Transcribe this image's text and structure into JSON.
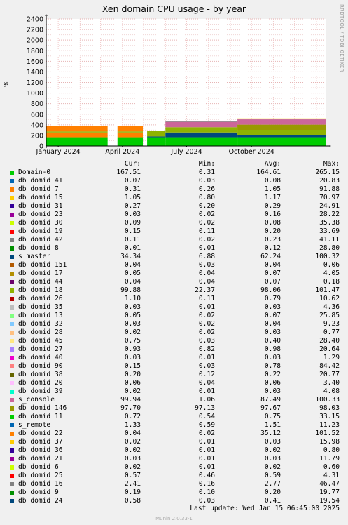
{
  "title": "Xen domain CPU usage - by year",
  "watermark": "RRDTOOL / TOBI OETIKER",
  "footer": {
    "last_update": "Last update:  Wed Jan 15 06:45:00 2025",
    "munin": "Munin 2.0.33-1"
  },
  "legend": {
    "headers": {
      "cur": "Cur:",
      "min": "Min:",
      "avg": "Avg:",
      "max": "Max:"
    },
    "rows": [
      {
        "name": "Domain-0",
        "color": "#00cc00",
        "cur": "167.51",
        "min": "0.31",
        "avg": "164.61",
        "max": "265.15"
      },
      {
        "name": "db domid 41",
        "color": "#0066b3",
        "cur": "0.07",
        "min": "0.03",
        "avg": "0.08",
        "max": "20.83"
      },
      {
        "name": "db domid 7",
        "color": "#ff8000",
        "cur": "0.31",
        "min": "0.26",
        "avg": "1.05",
        "max": "91.88"
      },
      {
        "name": "db domid 15",
        "color": "#ffcc00",
        "cur": "1.05",
        "min": "0.80",
        "avg": "1.17",
        "max": "70.97"
      },
      {
        "name": "db domid 31",
        "color": "#330099",
        "cur": "0.27",
        "min": "0.20",
        "avg": "0.29",
        "max": "24.91"
      },
      {
        "name": "db domid 23",
        "color": "#990099",
        "cur": "0.03",
        "min": "0.02",
        "avg": "0.16",
        "max": "28.22"
      },
      {
        "name": "db domid 30",
        "color": "#ccff00",
        "cur": "0.09",
        "min": "0.02",
        "avg": "0.08",
        "max": "35.38"
      },
      {
        "name": "db domid 19",
        "color": "#ff0000",
        "cur": "0.15",
        "min": "0.11",
        "avg": "0.20",
        "max": "33.69"
      },
      {
        "name": "db domid 42",
        "color": "#808080",
        "cur": "0.11",
        "min": "0.02",
        "avg": "0.23",
        "max": "41.11"
      },
      {
        "name": "db domid 8",
        "color": "#008f00",
        "cur": "0.01",
        "min": "0.01",
        "avg": "0.12",
        "max": "28.80"
      },
      {
        "name": "s_master",
        "color": "#00487d",
        "cur": "34.34",
        "min": "6.88",
        "avg": "62.24",
        "max": "100.32"
      },
      {
        "name": "db domid 151",
        "color": "#b35a00",
        "cur": "0.04",
        "min": "0.03",
        "avg": "0.04",
        "max": "0.06"
      },
      {
        "name": "db domid 17",
        "color": "#b38f00",
        "cur": "0.05",
        "min": "0.04",
        "avg": "0.07",
        "max": "4.05"
      },
      {
        "name": "db domid 44",
        "color": "#6b006b",
        "cur": "0.04",
        "min": "0.04",
        "avg": "0.07",
        "max": "0.18"
      },
      {
        "name": "db domid 18",
        "color": "#8fb300",
        "cur": "99.88",
        "min": "22.37",
        "avg": "98.06",
        "max": "101.47"
      },
      {
        "name": "db domid 26",
        "color": "#b30000",
        "cur": "1.10",
        "min": "0.11",
        "avg": "0.79",
        "max": "10.62"
      },
      {
        "name": "db domid 35",
        "color": "#bebebe",
        "cur": "0.03",
        "min": "0.01",
        "avg": "0.03",
        "max": "4.36"
      },
      {
        "name": "db domid 13",
        "color": "#80ff80",
        "cur": "0.05",
        "min": "0.02",
        "avg": "0.07",
        "max": "25.85"
      },
      {
        "name": "db domid 32",
        "color": "#80c9ff",
        "cur": "0.03",
        "min": "0.02",
        "avg": "0.04",
        "max": "9.23"
      },
      {
        "name": "db domid 28",
        "color": "#ffc080",
        "cur": "0.02",
        "min": "0.02",
        "avg": "0.03",
        "max": "0.77"
      },
      {
        "name": "db domid 45",
        "color": "#ffe680",
        "cur": "0.75",
        "min": "0.03",
        "avg": "0.40",
        "max": "28.40"
      },
      {
        "name": "db domid 27",
        "color": "#aa80ff",
        "cur": "0.93",
        "min": "0.82",
        "avg": "0.98",
        "max": "20.64"
      },
      {
        "name": "db domid 40",
        "color": "#ee00cc",
        "cur": "0.03",
        "min": "0.01",
        "avg": "0.03",
        "max": "1.29"
      },
      {
        "name": "db domid 90",
        "color": "#ff8080",
        "cur": "0.15",
        "min": "0.03",
        "avg": "0.78",
        "max": "84.42"
      },
      {
        "name": "db domid 38",
        "color": "#666600",
        "cur": "0.20",
        "min": "0.12",
        "avg": "0.22",
        "max": "20.77"
      },
      {
        "name": "db domid 20",
        "color": "#ffbfff",
        "cur": "0.06",
        "min": "0.04",
        "avg": "0.06",
        "max": "3.40"
      },
      {
        "name": "db domid 39",
        "color": "#00ffcc",
        "cur": "0.02",
        "min": "0.01",
        "avg": "0.03",
        "max": "4.08"
      },
      {
        "name": "s_console",
        "color": "#cc6699",
        "cur": "99.94",
        "min": "1.06",
        "avg": "87.49",
        "max": "100.33"
      },
      {
        "name": "db domid 146",
        "color": "#999900",
        "cur": "97.70",
        "min": "97.13",
        "avg": "97.67",
        "max": "98.03"
      },
      {
        "name": "db domid 11",
        "color": "#00cc00",
        "cur": "0.72",
        "min": "0.54",
        "avg": "0.75",
        "max": "33.15"
      },
      {
        "name": "s_remote",
        "color": "#0066b3",
        "cur": "1.33",
        "min": "0.59",
        "avg": "1.51",
        "max": "11.23"
      },
      {
        "name": "db domid 22",
        "color": "#ff8000",
        "cur": "0.04",
        "min": "0.02",
        "avg": "35.12",
        "max": "101.52"
      },
      {
        "name": "db domid 37",
        "color": "#ffcc00",
        "cur": "0.02",
        "min": "0.01",
        "avg": "0.03",
        "max": "15.98"
      },
      {
        "name": "db domid 36",
        "color": "#330099",
        "cur": "0.02",
        "min": "0.01",
        "avg": "0.02",
        "max": "0.80"
      },
      {
        "name": "db domid 21",
        "color": "#990099",
        "cur": "0.03",
        "min": "0.01",
        "avg": "0.03",
        "max": "11.79"
      },
      {
        "name": "db domid 6",
        "color": "#ccff00",
        "cur": "0.02",
        "min": "0.01",
        "avg": "0.02",
        "max": "0.60"
      },
      {
        "name": "db domid 25",
        "color": "#ff0000",
        "cur": "0.57",
        "min": "0.46",
        "avg": "0.59",
        "max": "4.31"
      },
      {
        "name": "db domid 16",
        "color": "#808080",
        "cur": "2.41",
        "min": "0.16",
        "avg": "2.77",
        "max": "46.47"
      },
      {
        "name": "db domid 9",
        "color": "#008f00",
        "cur": "0.19",
        "min": "0.10",
        "avg": "0.20",
        "max": "19.77"
      },
      {
        "name": "db domid 24",
        "color": "#00487d",
        "cur": "0.58",
        "min": "0.03",
        "avg": "0.41",
        "max": "19.54"
      }
    ]
  },
  "chart_data": {
    "type": "area",
    "title": "Xen domain CPU usage - by year",
    "ylabel": "%",
    "ylim": [
      0,
      2400
    ],
    "yticks": [
      0,
      200,
      400,
      600,
      800,
      1000,
      1200,
      1400,
      1600,
      1800,
      2000,
      2200,
      2400
    ],
    "xlim": [
      "2023-12-15",
      "2025-01-15"
    ],
    "xticks": [
      {
        "label": "January 2024",
        "date": "2024-01-01"
      },
      {
        "label": "April 2024",
        "date": "2024-04-01"
      },
      {
        "label": "July 2024",
        "date": "2024-07-01"
      },
      {
        "label": "October 2024",
        "date": "2024-10-01"
      }
    ],
    "grid": true,
    "stacked": true,
    "series": [
      {
        "name": "Domain-0",
        "color": "#00cc00",
        "segments": [
          {
            "from": "2023-12-15",
            "to": "2024-03-11",
            "value": 165
          },
          {
            "from": "2024-03-25",
            "to": "2024-04-30",
            "value": 165
          },
          {
            "from": "2024-05-06",
            "to": "2025-01-15",
            "value": 165
          }
        ]
      },
      {
        "name": "s_master",
        "color": "#00487d",
        "segments": [
          {
            "from": "2024-05-06",
            "to": "2024-05-31",
            "value": 15
          },
          {
            "from": "2024-06-01",
            "to": "2024-09-10",
            "value": 90
          },
          {
            "from": "2024-09-11",
            "to": "2025-01-15",
            "value": 40
          }
        ]
      },
      {
        "name": "db domid 7",
        "color": "#ff8000",
        "segments": [
          {
            "from": "2023-12-15",
            "to": "2024-03-11",
            "value": 90
          },
          {
            "from": "2024-03-25",
            "to": "2024-04-30",
            "value": 90
          }
        ]
      },
      {
        "name": "db domid 18",
        "color": "#8fb300",
        "segments": [
          {
            "from": "2023-12-15",
            "to": "2024-03-11",
            "value": 20
          },
          {
            "from": "2024-03-25",
            "to": "2024-04-30",
            "value": 20
          },
          {
            "from": "2024-05-06",
            "to": "2025-01-15",
            "value": 100
          }
        ]
      },
      {
        "name": "db domid 22",
        "color": "#ff8000",
        "segments": [
          {
            "from": "2023-12-15",
            "to": "2024-03-11",
            "value": 100
          },
          {
            "from": "2024-03-25",
            "to": "2024-04-30",
            "value": 100
          }
        ]
      },
      {
        "name": "db domid 146",
        "color": "#999900",
        "segments": [
          {
            "from": "2024-09-11",
            "to": "2025-01-15",
            "value": 98
          }
        ]
      },
      {
        "name": "s_console",
        "color": "#cc6699",
        "segments": [
          {
            "from": "2024-06-01",
            "to": "2024-09-10",
            "value": 100
          },
          {
            "from": "2024-09-11",
            "to": "2025-01-15",
            "value": 100
          }
        ]
      },
      {
        "name": "db domid 16",
        "color": "#808080",
        "segments": [
          {
            "from": "2023-12-15",
            "to": "2024-03-11",
            "value": 5
          },
          {
            "from": "2024-05-06",
            "to": "2025-01-15",
            "value": 10
          }
        ]
      },
      {
        "name": "db domid 90",
        "color": "#ff8080",
        "segments": [
          {
            "from": "2024-09-11",
            "to": "2025-01-15",
            "value": 5
          }
        ]
      },
      {
        "name": "db domid 45",
        "color": "#ffe680",
        "segments": [
          {
            "from": "2024-09-11",
            "to": "2025-01-15",
            "value": 5
          }
        ]
      }
    ]
  }
}
